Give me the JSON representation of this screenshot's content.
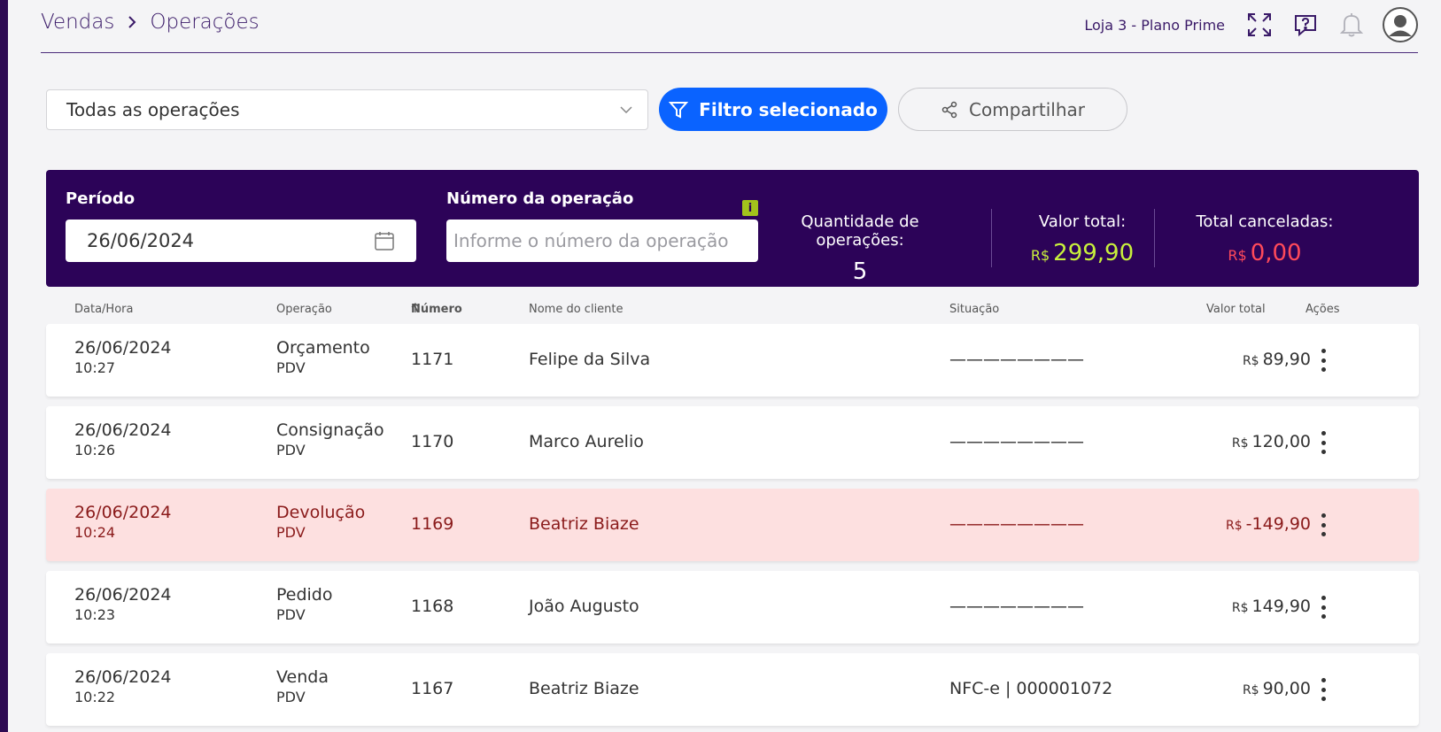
{
  "breadcrumb": {
    "root": "Vendas",
    "current": "Operações"
  },
  "header": {
    "store_label": "Loja 3 - Plano Prime"
  },
  "toolbar": {
    "operations_select": "Todas as operações",
    "filter_button": "Filtro selecionado",
    "share_button": "Compartilhar"
  },
  "summary": {
    "period_label": "Período",
    "period_value": "26/06/2024",
    "op_number_label": "Número da operação",
    "op_number_placeholder": "Informe o número da operação",
    "info_badge": "i",
    "qty_label": "Quantidade de operações:",
    "qty_value": "5",
    "total_label": "Valor total:",
    "total_currency": "R$",
    "total_value": "299,90",
    "cancelled_label": "Total canceladas:",
    "cancelled_currency": "R$",
    "cancelled_value": "0,00"
  },
  "colors": {
    "panel": "#2c0358",
    "accent_blue": "#0a63ff",
    "total_green": "#c8f03c",
    "cancelled_red": "#ff4a5a"
  },
  "table": {
    "headers": {
      "datetime": "Data/Hora",
      "operation": "Operação",
      "number": "Número",
      "client": "Nome do cliente",
      "status": "Situação",
      "value": "Valor total",
      "actions": "Ações"
    },
    "rows": [
      {
        "date": "26/06/2024",
        "time": "10:27",
        "op": "Orçamento",
        "channel": "PDV",
        "number": "1171",
        "client": "Felipe da Silva",
        "status": "————————",
        "currency": "R$",
        "value": "89,90"
      },
      {
        "date": "26/06/2024",
        "time": "10:26",
        "op": "Consignação",
        "channel": "PDV",
        "number": "1170",
        "client": "Marco Aurelio",
        "status": "————————",
        "currency": "R$",
        "value": "120,00"
      },
      {
        "date": "26/06/2024",
        "time": "10:24",
        "op": "Devolução",
        "channel": "PDV",
        "number": "1169",
        "client": "Beatriz Biaze",
        "status": "————————",
        "currency": "R$",
        "value": "-149,90"
      },
      {
        "date": "26/06/2024",
        "time": "10:23",
        "op": "Pedido",
        "channel": "PDV",
        "number": "1168",
        "client": "João Augusto",
        "status": "————————",
        "currency": "R$",
        "value": "149,90"
      },
      {
        "date": "26/06/2024",
        "time": "10:22",
        "op": "Venda",
        "channel": "PDV",
        "number": "1167",
        "client": "Beatriz Biaze",
        "status": "NFC-e | 000001072",
        "currency": "R$",
        "value": "90,00"
      }
    ]
  }
}
